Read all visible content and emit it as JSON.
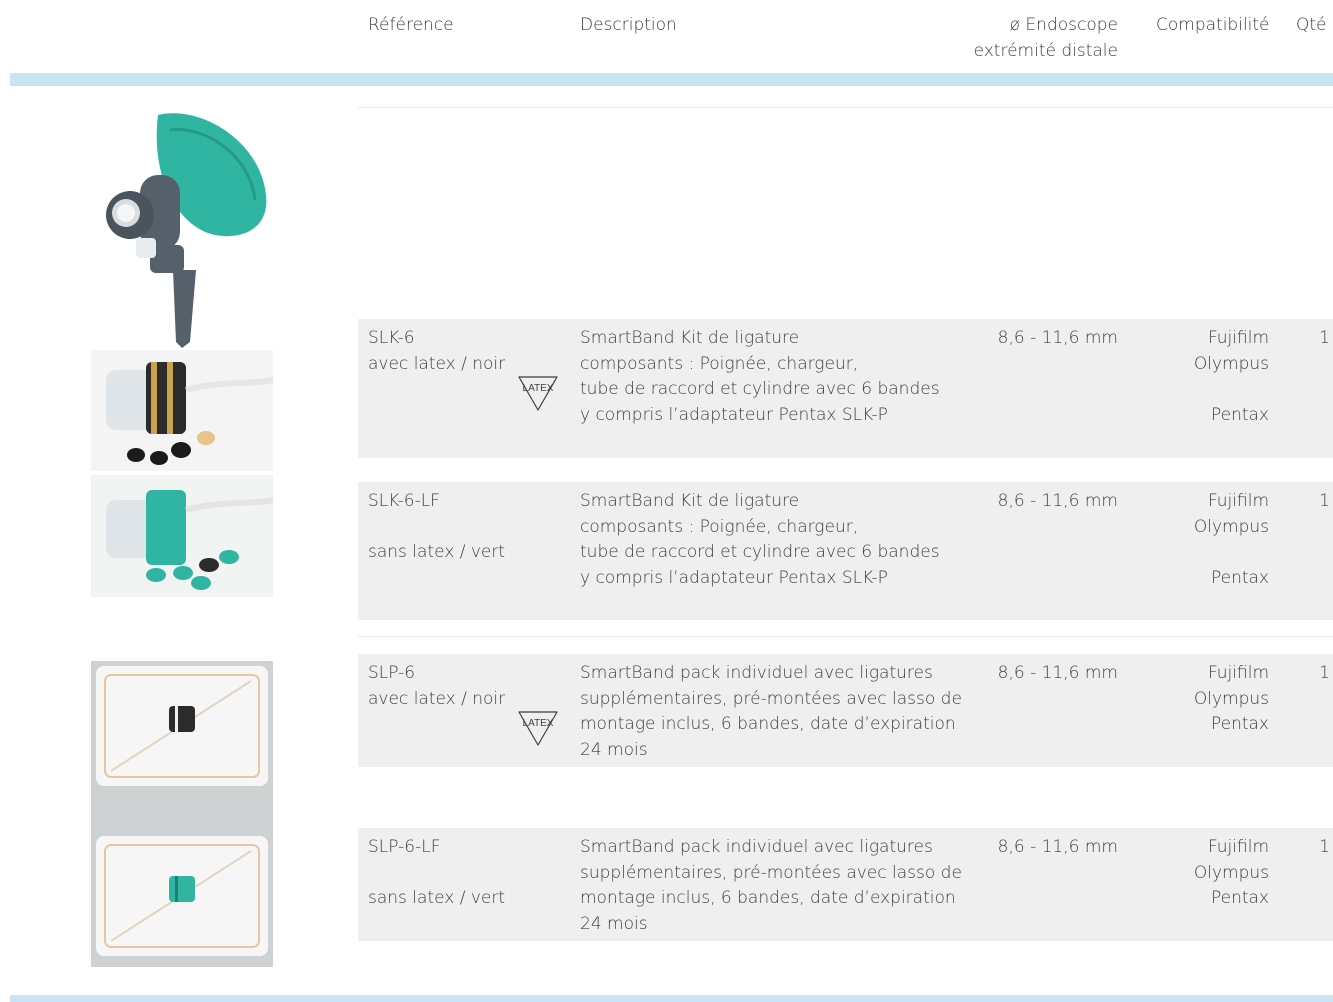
{
  "header": {
    "reference": "Référence",
    "description": "Description",
    "endoscope_line1": "ø Endoscope",
    "endoscope_line2": "extrémité distale",
    "compatibility": "Compatibilité",
    "qty": "Qté"
  },
  "latex_label": "LATEX",
  "colors": {
    "band": "#cbe4f3",
    "row_bg": "#efefef",
    "teal": "#2fb5a2"
  },
  "products": [
    {
      "ref": "SLK-6",
      "variant": "avec latex / noir",
      "desc": [
        "SmartBand Kit de ligature",
        "composants : Poignée, chargeur,",
        "tube de raccord et cylindre avec 6 bandes",
        "y compris l’adaptateur Pentax SLK-P"
      ],
      "diameter": "8,6 - 11,6 mm",
      "compat": [
        "Fujifilm",
        "Olympus",
        "Pentax"
      ],
      "qty": "1"
    },
    {
      "ref": "SLK-6-LF",
      "variant": "sans latex / vert",
      "desc": [
        "SmartBand Kit de ligature",
        "composants : Poignée, chargeur,",
        "tube de raccord et cylindre avec 6 bandes",
        "y compris l’adaptateur Pentax SLK-P"
      ],
      "diameter": "8,6 - 11,6 mm",
      "compat": [
        "Fujifilm",
        "Olympus",
        "Pentax"
      ],
      "qty": "1"
    },
    {
      "ref": "SLP-6",
      "variant": "avec latex / noir",
      "desc": [
        "SmartBand pack individuel avec ligatures",
        "supplémentaires, pré-montées avec lasso de",
        "montage inclus, 6 bandes, date d’expiration",
        "24 mois"
      ],
      "diameter": "8,6 - 11,6 mm",
      "compat": [
        "Fujifilm",
        "Olympus",
        "Pentax"
      ],
      "qty": "1"
    },
    {
      "ref": "SLP-6-LF",
      "variant": "sans latex / vert",
      "desc": [
        "SmartBand pack individuel avec ligatures",
        "supplémentaires, pré-montées avec lasso de",
        "montage inclus, 6 bandes, date d’expiration",
        "24 mois"
      ],
      "diameter": "8,6 - 11,6 mm",
      "compat": [
        "Fujifilm",
        "Olympus",
        "Pentax"
      ],
      "qty": "1"
    }
  ]
}
